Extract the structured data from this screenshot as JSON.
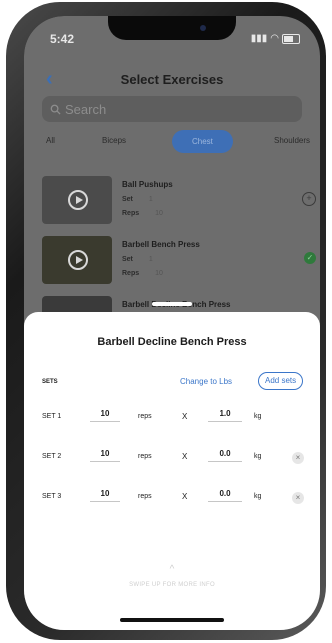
{
  "status": {
    "time": "5:42"
  },
  "header": {
    "back": "‹",
    "title": "Select Exercises"
  },
  "search": {
    "placeholder": "Search",
    "icon": "search-icon"
  },
  "categories": [
    {
      "label": "All",
      "active": false
    },
    {
      "label": "Biceps",
      "active": false
    },
    {
      "label": "Chest",
      "active": true
    },
    {
      "label": "Shoulders",
      "active": false
    }
  ],
  "exercises": [
    {
      "name": "Ball Pushups",
      "set_label": "Set",
      "set_value": "1",
      "reps_label": "Reps",
      "reps_value": "10",
      "action_icon": "add-icon"
    },
    {
      "name": "Barbell Bench Press",
      "set_label": "Set",
      "set_value": "1",
      "reps_label": "Reps",
      "reps_value": "10",
      "action_icon": "check-icon"
    },
    {
      "name": "Barbell Decline Bench Press"
    }
  ],
  "sheet": {
    "title": "Barbell Decline Bench Press",
    "sets_label": "SETS",
    "change_units": "Change to Lbs",
    "add_sets": "Add sets",
    "sets": [
      {
        "name": "SET 1",
        "reps": "10",
        "reps_unit": "reps",
        "times": "X",
        "weight": "1.0",
        "weight_unit": "kg",
        "removable": false
      },
      {
        "name": "SET 2",
        "reps": "10",
        "reps_unit": "reps",
        "times": "X",
        "weight": "0.0",
        "weight_unit": "kg",
        "removable": true
      },
      {
        "name": "SET 3",
        "reps": "10",
        "reps_unit": "reps",
        "times": "X",
        "weight": "0.0",
        "weight_unit": "kg",
        "removable": true
      }
    ],
    "chevron": "^",
    "swipe_hint": "SWIPE UP FOR MORE INFO"
  }
}
